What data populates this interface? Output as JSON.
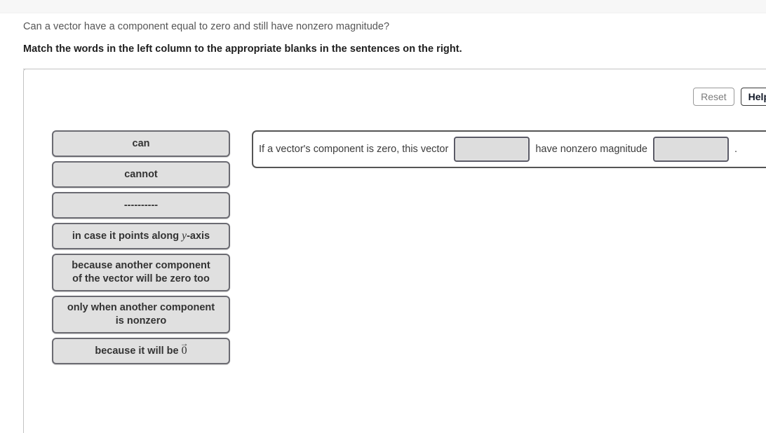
{
  "header": {
    "prompt": "Can a vector have a component equal to zero and still have nonzero magnitude?",
    "instruction": "Match the words in the left column to the appropriate blanks in the sentences on the right."
  },
  "toolbar": {
    "reset_label": "Reset",
    "help_label": "Help"
  },
  "word_bank": {
    "tiles": [
      {
        "text": "can",
        "lines": 1
      },
      {
        "text": "cannot",
        "lines": 1
      },
      {
        "text": "----------",
        "lines": 1
      },
      {
        "text": "in case it points along y-axis",
        "lines": 1
      },
      {
        "text": "because another component of the vector will be zero too",
        "lines": 2
      },
      {
        "text": "only when another component is nonzero",
        "lines": 2
      },
      {
        "text": "because it will be 0",
        "lines": 1
      }
    ],
    "tile_1_label": "can",
    "tile_2_label": "cannot",
    "tile_3_label": "----------",
    "tile_4_prefix": "in case it points along ",
    "tile_4_math": "y",
    "tile_4_suffix": "-axis",
    "tile_5_line1": "because another component",
    "tile_5_line2": "of the vector will be zero too",
    "tile_6_line1": "only when another component",
    "tile_6_line2": "is nonzero",
    "tile_7_prefix": "because it will be ",
    "tile_7_vector": "0",
    "tile_7_arrow": "→"
  },
  "sentence": {
    "part1": "If a vector's component is zero, this vector",
    "part2": "have nonzero magnitude",
    "period": ".",
    "blank1_value": "",
    "blank2_value": ""
  },
  "colors": {
    "tile_fill": "#e0e0e0",
    "tile_border": "#6b6b72",
    "blank_fill": "#dddddd",
    "blank_border": "#5a5a66",
    "panel_border": "#c3c3c3",
    "top_strip": "#f7f7f7"
  }
}
